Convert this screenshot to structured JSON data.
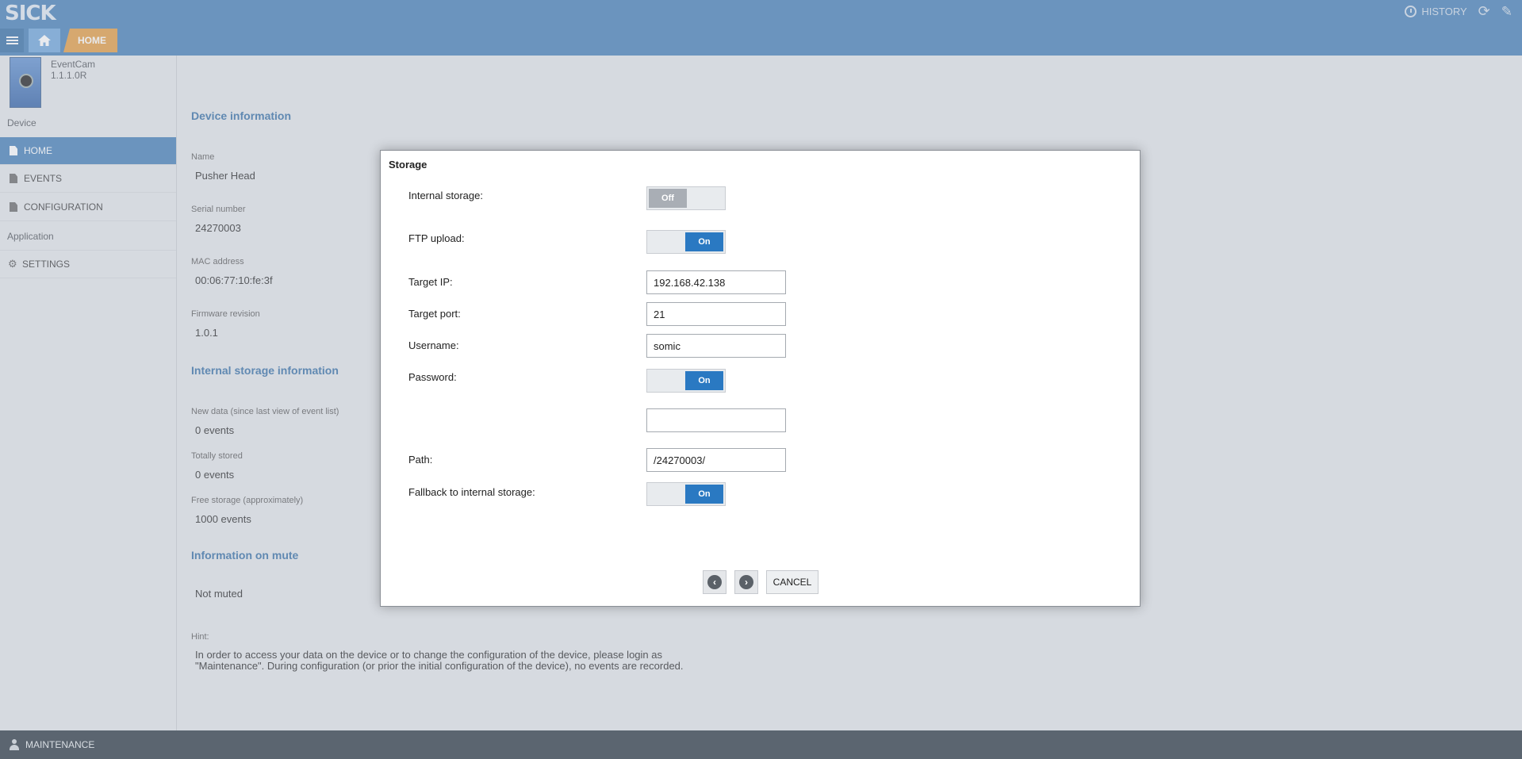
{
  "header": {
    "logo": "SICK",
    "history_label": "HISTORY",
    "breadcrumb_home": "HOME"
  },
  "sidebar": {
    "device_name": "EventCam",
    "device_version": "1.1.1.0R",
    "section_device": "Device",
    "section_application": "Application",
    "items": [
      {
        "label": "HOME"
      },
      {
        "label": "EVENTS"
      },
      {
        "label": "CONFIGURATION"
      },
      {
        "label": "SETTINGS"
      }
    ]
  },
  "main": {
    "device_info_heading": "Device information",
    "name_label": "Name",
    "name_value": "Pusher Head",
    "serial_label": "Serial number",
    "serial_value": "24270003",
    "mac_label": "MAC address",
    "mac_value": "00:06:77:10:fe:3f",
    "firmware_label": "Firmware revision",
    "firmware_value": "1.0.1",
    "storage_heading": "Internal storage information",
    "new_data_label": "New data (since last view of event list)",
    "new_data_value": "0 events",
    "total_label": "Totally stored",
    "total_value": "0 events",
    "free_label": "Free storage (approximately)",
    "free_value": "1000 events",
    "mute_heading": "Information on mute",
    "mute_value": "Not muted",
    "hint_label": "Hint:",
    "hint_text": "In order to access your data on the device or to change the configuration of the device, please login as \"Maintenance\". During configuration (or prior the initial configuration of the device), no events are recorded."
  },
  "dialog": {
    "title": "Storage",
    "internal_storage_label": "Internal storage:",
    "internal_storage_state": "Off",
    "ftp_upload_label": "FTP upload:",
    "ftp_upload_state": "On",
    "target_ip_label": "Target IP:",
    "target_ip_value": "192.168.42.138",
    "target_port_label": "Target port:",
    "target_port_value": "21",
    "username_label": "Username:",
    "username_value": "somic",
    "password_label": "Password:",
    "password_state": "On",
    "password_value": "",
    "path_label": "Path:",
    "path_value": "/24270003/",
    "fallback_label": "Fallback to internal storage:",
    "fallback_state": "On",
    "cancel_label": "CANCEL"
  },
  "footer": {
    "user_role": "MAINTENANCE"
  },
  "colors": {
    "brand_blue": "#3f7cb6",
    "accent_orange": "#e39a3d",
    "toggle_on": "#2a79c2"
  }
}
